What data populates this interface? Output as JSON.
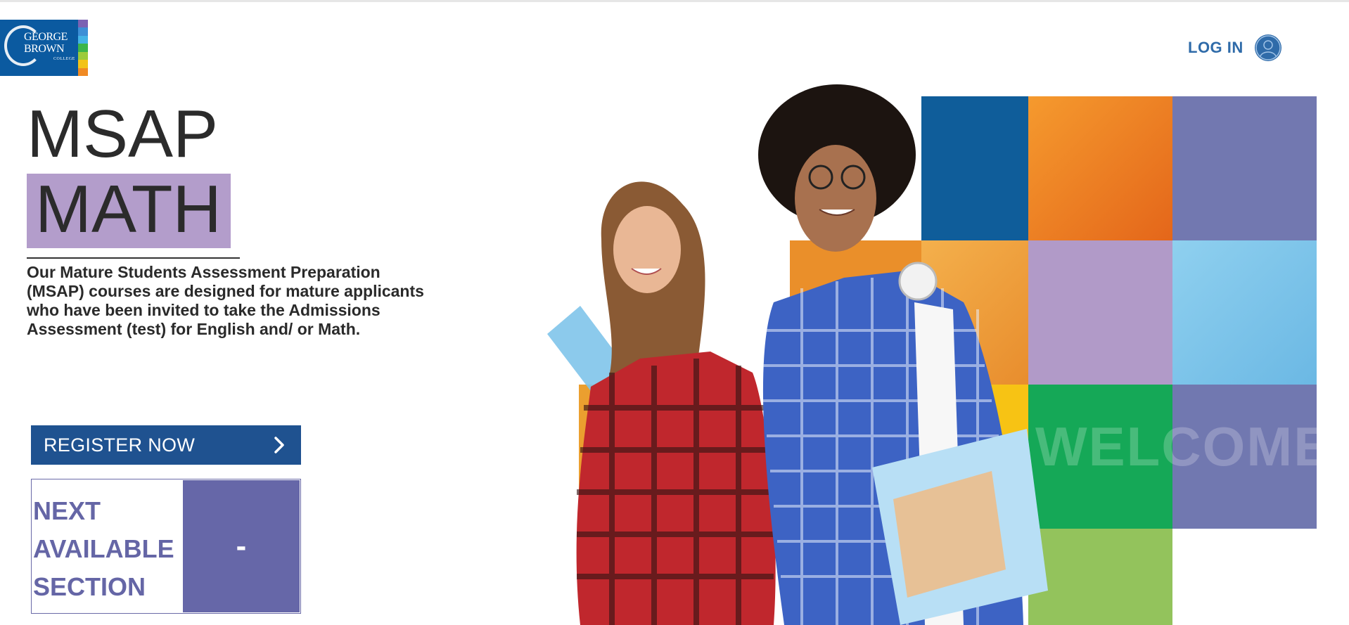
{
  "header": {
    "logo": {
      "line1": "GEORGE",
      "line2": "BROWN",
      "line3": "COLLEGE",
      "stripe_colors": [
        "#7b62b3",
        "#3d8fd6",
        "#43b3e6",
        "#3bb54a",
        "#9ccb3b",
        "#f2c318",
        "#f08a24"
      ]
    },
    "login_label": "LOG IN",
    "login_icon": "user-circle-icon"
  },
  "hero": {
    "title_line1": "MSAP",
    "title_line2": "MATH",
    "description": "Our Mature Students Assessment Preparation (MSAP) courses are designed for mature applicants who have been invited to take the Admissions Assessment (test) for English and/ or Math.",
    "register_label": "REGISTER NOW",
    "register_icon": "chevron-right-icon",
    "next_section_label_lines": [
      "NEXT",
      "AVAILABLE",
      "SECTION"
    ],
    "next_section_value": "-",
    "welcome_text": "WELCOME"
  },
  "colors": {
    "brand_blue": "#1f5290",
    "login_blue": "#2f6ba9",
    "math_highlight": "#b39dcb",
    "section_purple": "#6667a8"
  }
}
